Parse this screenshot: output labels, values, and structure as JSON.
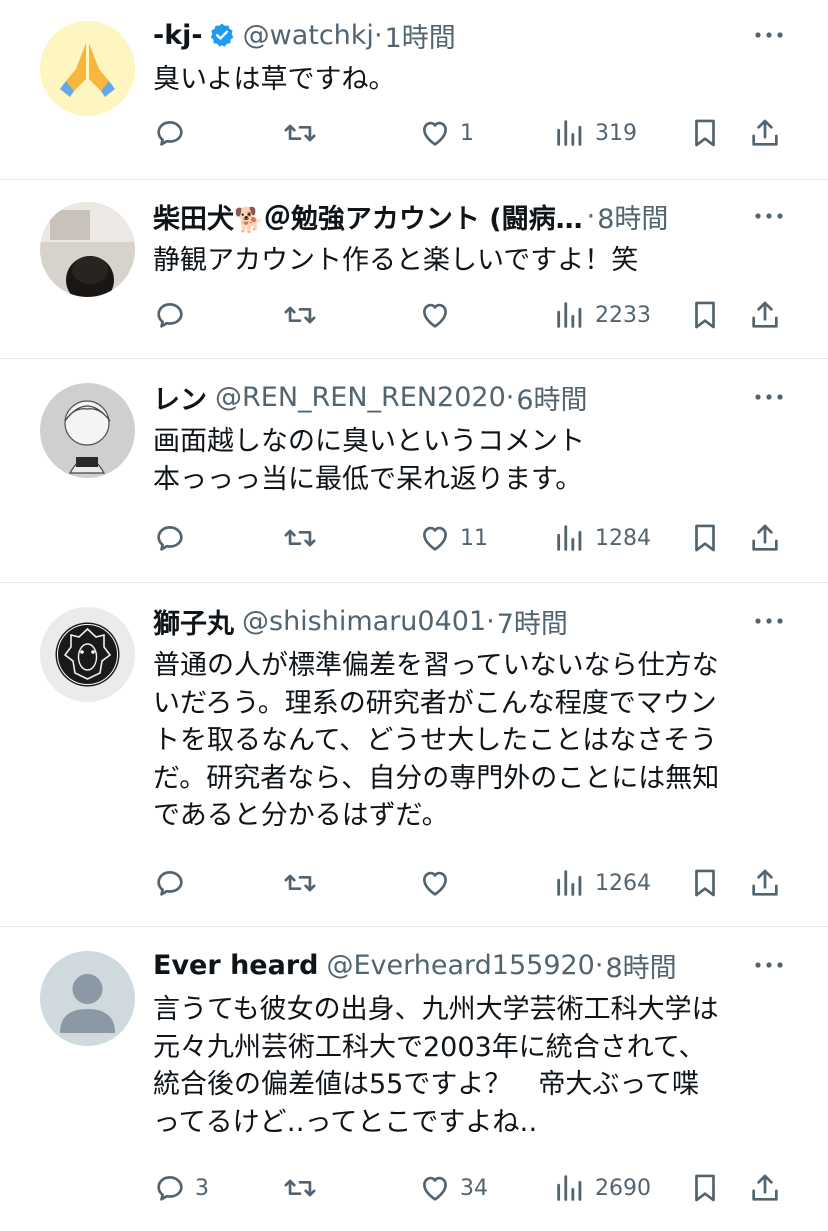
{
  "colors": {
    "text": "#0f1419",
    "secondary": "#536471",
    "verified": "#1d9bf0",
    "divider": "#e6e9ec"
  },
  "tweets": [
    {
      "name": "-kj-",
      "verified": true,
      "handle": "@watchkj",
      "separator": "·",
      "time": "1時間",
      "avatar": "praying-hands-emoji-avatar",
      "body": [
        "臭いよは草ですね。"
      ],
      "replies": "",
      "likes": "1",
      "views": "319"
    },
    {
      "name": "柴田犬",
      "name_emoji": "🐕",
      "name_suffix": "＠勉強アカウント (闘病…",
      "handle": "",
      "separator": "·",
      "time": "8時間",
      "avatar": "photo-avatar",
      "body": [
        "静観アカウント作ると楽しいですよ！笑"
      ],
      "replies": "",
      "likes": "",
      "views": "2233"
    },
    {
      "name": "レン",
      "handle": "@REN_REN_REN2020",
      "separator": "·",
      "time": "6時間",
      "avatar": "illustration-avatar",
      "body": [
        "画面越しなのに臭いというコメント",
        "本っっっ当に最低で呆れ返ります。"
      ],
      "replies": "",
      "likes": "11",
      "views": "1284"
    },
    {
      "name": "獅子丸",
      "handle": "@shishimaru0401",
      "separator": "·",
      "time": "7時間",
      "avatar": "lion-logo-avatar",
      "body": [
        "普通の人が標準偏差を習っていないなら仕方な",
        "いだろう。理系の研究者がこんな程度でマウン",
        "トを取るなんて、どうせ大したことはなさそう",
        "だ。研究者なら、自分の専門外のことには無知",
        "であると分かるはずだ。"
      ],
      "replies": "",
      "likes": "",
      "views": "1264"
    },
    {
      "name": "Ever heard",
      "handle": "@Everheard155920",
      "separator": "·",
      "time": "8時間",
      "avatar": "default-avatar",
      "body": [
        "言うても彼女の出身、九州大学芸術工科大学は",
        "元々九州芸術工科大で2003年に統合されて、",
        "統合後の偏差値は55ですよ？　帝大ぶって喋",
        "ってるけど‥ってとこですよね‥"
      ],
      "replies": "3",
      "likes": "34",
      "views": "2690"
    }
  ]
}
